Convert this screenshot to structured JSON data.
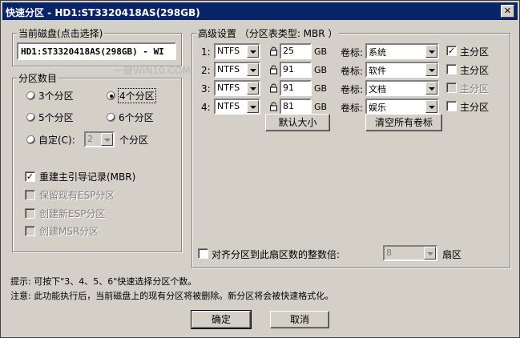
{
  "window": {
    "title": "快速分区 - HD1:ST3320418AS(298GB)"
  },
  "disk_group": {
    "legend": "当前磁盘(点击选择)",
    "value": "HD1:ST3320418AS(298GB) - WI"
  },
  "count_group": {
    "legend": "分区数目",
    "options": [
      {
        "label": "3个分区",
        "selected": false
      },
      {
        "label": "4个分区",
        "selected": true
      },
      {
        "label": "5个分区",
        "selected": false
      },
      {
        "label": "6个分区",
        "selected": false
      }
    ],
    "custom_label": "自定(C):",
    "custom_value": "2",
    "custom_suffix": "个分区",
    "checks": [
      {
        "label": "重建主引导记录(MBR)",
        "checked": true,
        "enabled": true
      },
      {
        "label": "保留现有ESP分区",
        "checked": false,
        "enabled": false
      },
      {
        "label": "创建新ESP分区",
        "checked": false,
        "enabled": false
      },
      {
        "label": "创建MSR分区",
        "checked": false,
        "enabled": false
      }
    ]
  },
  "advanced": {
    "legend": "高级设置 （分区表类型: MBR ）",
    "rows": [
      {
        "num": "1:",
        "fs": "NTFS",
        "size": "25",
        "unit": "GB",
        "vol_label": "卷标:",
        "vol": "系统",
        "primary_label": "主分区",
        "primary": true,
        "primary_enabled": true,
        "locked": true
      },
      {
        "num": "2:",
        "fs": "NTFS",
        "size": "91",
        "unit": "GB",
        "vol_label": "卷标:",
        "vol": "软件",
        "primary_label": "主分区",
        "primary": false,
        "primary_enabled": true,
        "locked": false
      },
      {
        "num": "3:",
        "fs": "NTFS",
        "size": "91",
        "unit": "GB",
        "vol_label": "卷标:",
        "vol": "文档",
        "primary_label": "主分区",
        "primary": false,
        "primary_enabled": false,
        "locked": false
      },
      {
        "num": "4:",
        "fs": "NTFS",
        "size": "81",
        "unit": "GB",
        "vol_label": "卷标:",
        "vol": "娱乐",
        "primary_label": "主分区",
        "primary": false,
        "primary_enabled": true,
        "locked": false
      }
    ],
    "default_size_btn": "默认大小",
    "clear_labels_btn": "清空所有卷标",
    "align_label": "对齐分区到此扇区数的整数倍:",
    "align_value": "8",
    "align_unit": "扇区"
  },
  "watermark": "一键WIN10.COM",
  "hints": {
    "tip": "提示: 可按下\"3、4、5、6\"快速选择分区个数。",
    "note": "注意: 此功能执行后，当前磁盘上的现有分区将被删除。新分区将会被快速格式化。"
  },
  "buttons": {
    "ok": "确定",
    "cancel": "取消"
  }
}
